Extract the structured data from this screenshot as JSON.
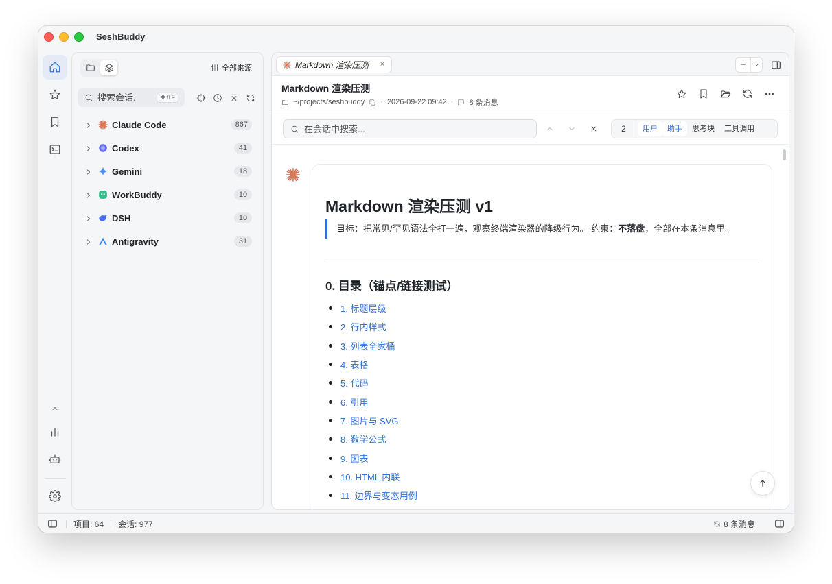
{
  "app": {
    "title": "SeshBuddy"
  },
  "sidebar": {
    "source_filter_label": "全部来源",
    "search": {
      "placeholder": "搜索会话.",
      "shortcut": "⌘⇧F"
    },
    "sources": [
      {
        "name": "Claude Code",
        "count": "867",
        "icon": "claude-logo",
        "color": "#d97757"
      },
      {
        "name": "Codex",
        "count": "41",
        "icon": "codex-logo",
        "color": "#6b6fe8"
      },
      {
        "name": "Gemini",
        "count": "18",
        "icon": "gemini-logo",
        "color": "#4a8df0"
      },
      {
        "name": "WorkBuddy",
        "count": "10",
        "icon": "workbuddy-logo",
        "color": "#2fbf8a"
      },
      {
        "name": "DSH",
        "count": "10",
        "icon": "dsh-logo",
        "color": "#4b6ef5"
      },
      {
        "name": "Antigravity",
        "count": "31",
        "icon": "antigravity-logo",
        "color": "#4285f4"
      }
    ]
  },
  "tab": {
    "title": "Markdown 渲染压测",
    "close": "×",
    "add": "+"
  },
  "session": {
    "title": "Markdown 渲染压测",
    "path": "~/projects/seshbuddy",
    "datetime": "2026-09-22 09:42",
    "message_count": "8 条消息"
  },
  "findbar": {
    "placeholder": "在会话中搜索...",
    "count": "2",
    "filters": [
      {
        "label": "用户",
        "active": true
      },
      {
        "label": "助手",
        "active": true
      },
      {
        "label": "思考块",
        "active": false
      },
      {
        "label": "工具调用",
        "active": false
      }
    ]
  },
  "message": {
    "h1": "Markdown 渲染压测 v1",
    "quote_prefix": "目标：把常见/罕见语法全打一遍，观察终端渲染器的降级行为。 约束：",
    "quote_bold": "不落盘",
    "quote_suffix": "，全部在本条消息里。",
    "h2": "0. 目录（锚点/链接测试）",
    "toc": [
      "1. 标题层级",
      "2. 行内样式",
      "3. 列表全家桶",
      "4. 表格",
      "5. 代码",
      "6. 引用",
      "7. 图片与 SVG",
      "8. 数学公式",
      "9. 图表",
      "10. HTML 内联",
      "11. 边界与变态用例"
    ]
  },
  "statusbar": {
    "projects": "项目: 64",
    "sessions": "会话: 977",
    "messages": "8 条消息"
  },
  "colors": {
    "accent": "#2f6fd8",
    "claude": "#d97757"
  }
}
